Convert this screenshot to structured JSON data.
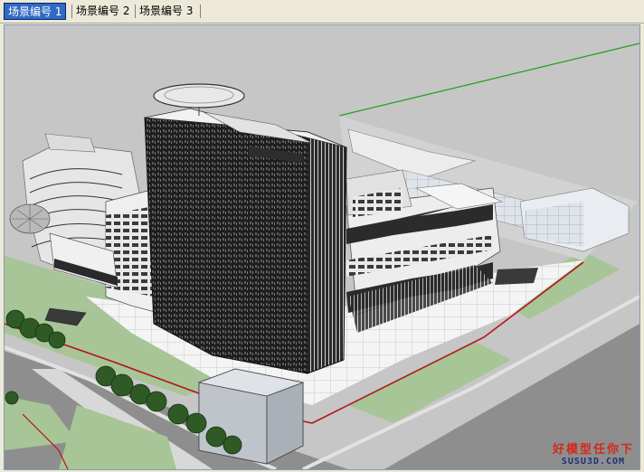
{
  "tabs": [
    {
      "label": "场景编号 1",
      "active": true
    },
    {
      "label": "场景编号 2",
      "active": false
    },
    {
      "label": "场景编号 3",
      "active": false
    }
  ],
  "colors": {
    "tab_active_bg": "#316ac5",
    "ground": "#c6c6c6",
    "road": "#8e8e8e",
    "grass": "#9fbf8a",
    "building_dark": "#2a2a2a",
    "building_light": "#e6e6e6",
    "green_axis": "#1e9e1e",
    "red_axis": "#b4141a"
  },
  "watermark": {
    "line1": "好模型任你下",
    "line2": "SUSU3D.COM"
  }
}
